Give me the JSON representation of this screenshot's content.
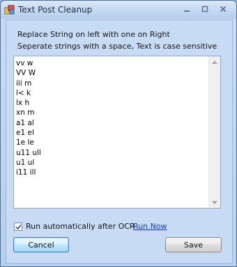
{
  "window": {
    "title": "Text Post Cleanup"
  },
  "instructions": {
    "line1": "Replace String on left with one on Right",
    "line2": "Seperate strings with a space, Text is case sensitive"
  },
  "replacements_text": "vv w\nVV W\niii m\nl< k\nlx h\nxn m\na1 al\ne1 el\n1e le\nu11 ull\nu1 ul\ni11 ill",
  "options": {
    "auto_run_label": "Run automatically after OCR",
    "auto_run_checked": true,
    "run_now_label": "Run Now"
  },
  "buttons": {
    "cancel_label": "Cancel",
    "save_label": "Save"
  },
  "colors": {
    "title_bar": "#c4d8f2",
    "client_bg": "#c7dcf4",
    "link": "#1b3bb5"
  }
}
